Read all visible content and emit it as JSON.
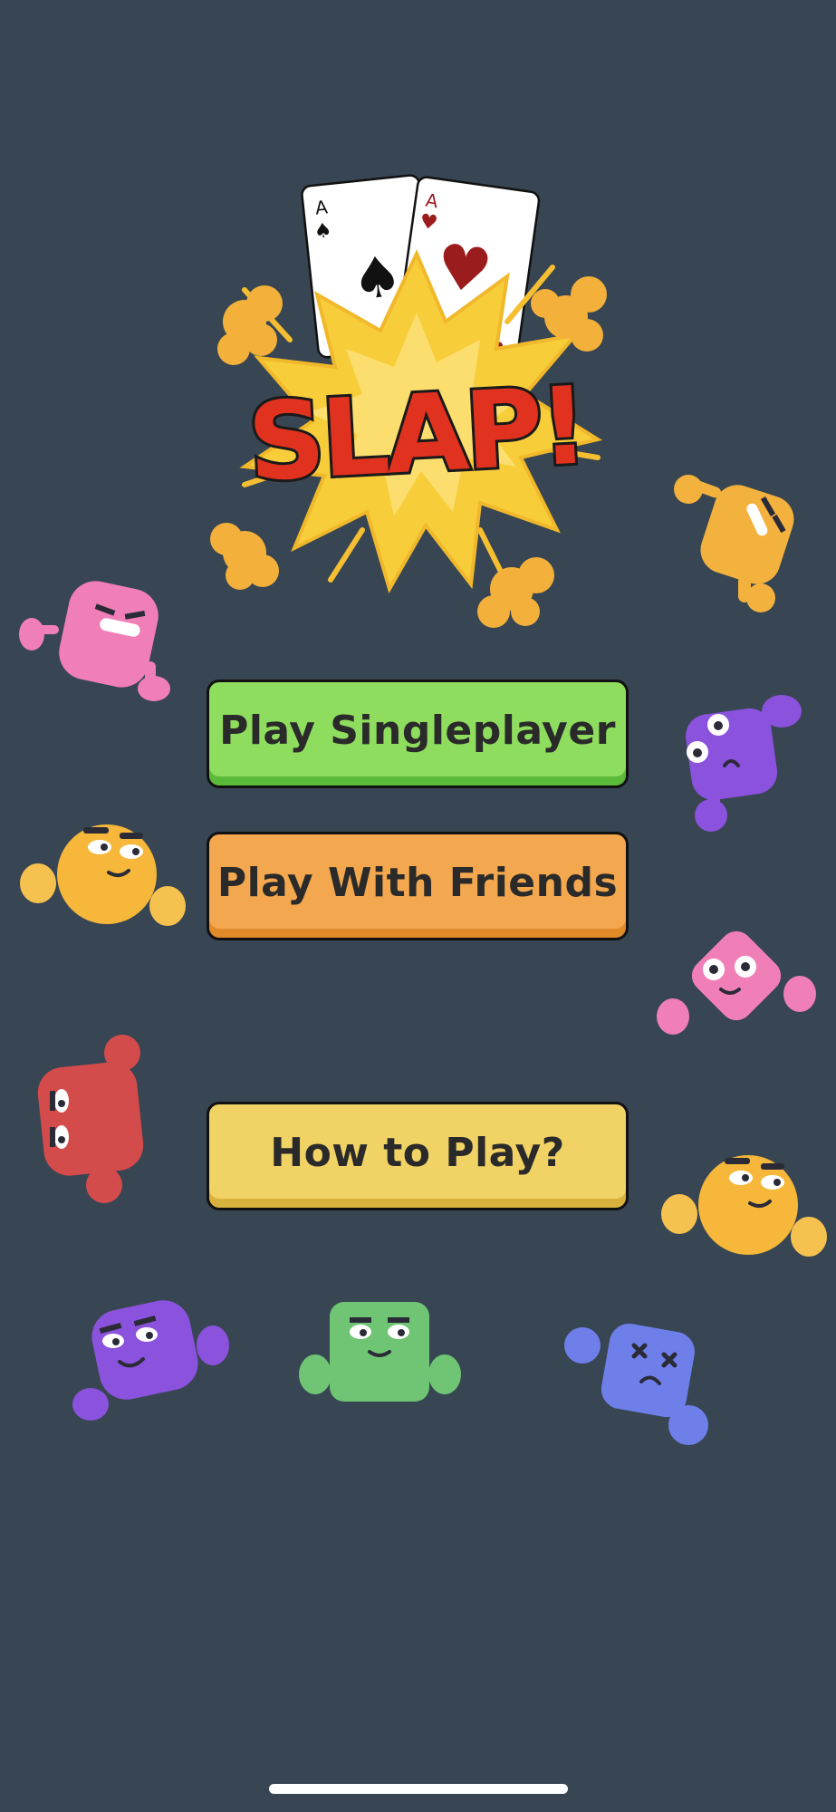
{
  "logo": {
    "title": "SLAP!",
    "card_rank": "A",
    "colors": {
      "slap_red": "#e0321f",
      "burst_yellow": "#f8cd3a",
      "smoke_orange": "#f3b03b",
      "heart_red": "#9b1c1c"
    }
  },
  "menu": {
    "single_label": "Play Singleplayer",
    "friends_label": "Play With Friends",
    "howto_label": "How to Play?"
  },
  "theme": {
    "background": "#384552",
    "single_color": "#8fdd5f",
    "friends_color": "#f3a74e",
    "howto_color": "#f1d265"
  },
  "mascots": [
    "pink-angry-blob",
    "yellow-blob-top-right",
    "purple-worried-blob",
    "yellow-smug-ball-left",
    "pink-diamond-blob",
    "red-blob-left",
    "yellow-smug-ball-right",
    "purple-happy-blob",
    "green-square-blob",
    "blue-dizzy-blob"
  ]
}
